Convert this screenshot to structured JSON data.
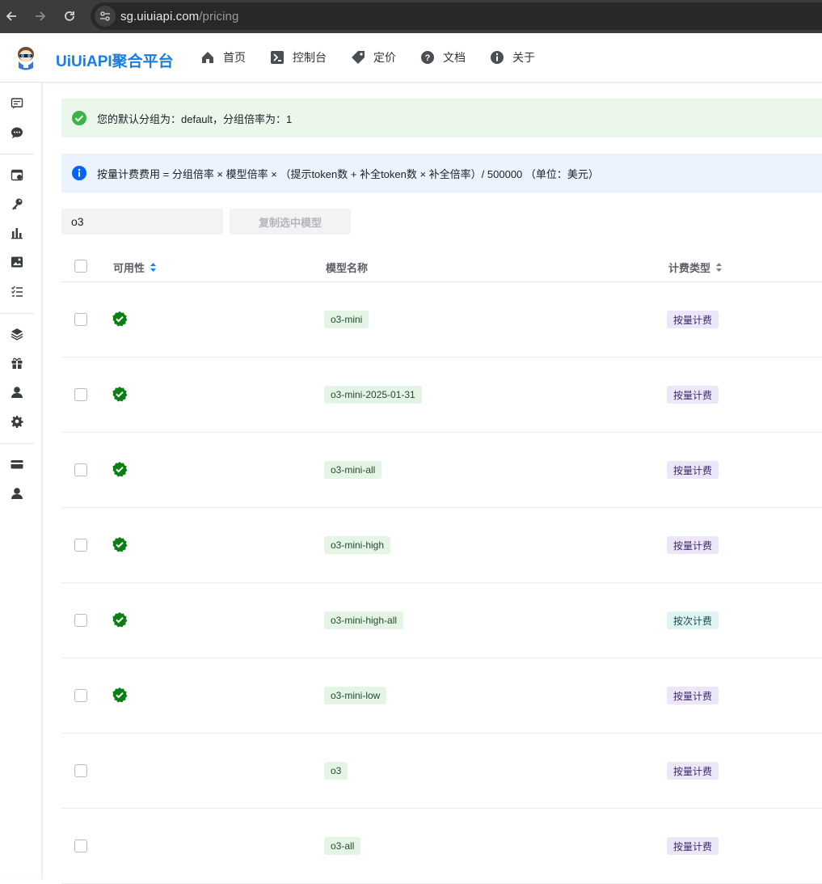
{
  "browser": {
    "url_host": "sg.uiuiapi.com",
    "url_path": "/pricing"
  },
  "header": {
    "brand": "UiUiAPI聚合平台",
    "nav": [
      {
        "label": "首页",
        "icon": "home-icon"
      },
      {
        "label": "控制台",
        "icon": "terminal-icon"
      },
      {
        "label": "定价",
        "icon": "tag-icon"
      },
      {
        "label": "文档",
        "icon": "help-icon"
      },
      {
        "label": "关于",
        "icon": "info-icon"
      }
    ]
  },
  "sidebar": {
    "items": [
      "chat-list-icon",
      "chat-bubble-icon",
      "calendar-icon",
      "key-icon",
      "bar-chart-icon",
      "image-icon",
      "task-list-icon",
      "layers-icon",
      "gift-icon",
      "user-icon",
      "settings-icon",
      "card-icon",
      "profile-icon"
    ]
  },
  "banners": {
    "group_info": "您的默认分组为：default，分组倍率为：1",
    "formula": "按量计费费用 = 分组倍率 × 模型倍率 × （提示token数 + 补全token数 × 补全倍率）/ 500000 （单位：美元）"
  },
  "search": {
    "value": "o3"
  },
  "copy_button": "复制选中模型",
  "table": {
    "columns": {
      "availability": "可用性",
      "model_name": "模型名称",
      "billing_type": "计费类型"
    },
    "rows": [
      {
        "available": true,
        "model": "o3-mini",
        "billing": "按量计费"
      },
      {
        "available": true,
        "model": "o3-mini-2025-01-31",
        "billing": "按量计费"
      },
      {
        "available": true,
        "model": "o3-mini-all",
        "billing": "按量计费"
      },
      {
        "available": true,
        "model": "o3-mini-high",
        "billing": "按量计费"
      },
      {
        "available": true,
        "model": "o3-mini-high-all",
        "billing": "按次计费"
      },
      {
        "available": true,
        "model": "o3-mini-low",
        "billing": "按量计费"
      },
      {
        "available": false,
        "model": "o3",
        "billing": "按量计费"
      },
      {
        "available": false,
        "model": "o3-all",
        "billing": "按量计费"
      }
    ]
  },
  "colors": {
    "brand": "#1a7de0",
    "success": "#0e8a16",
    "info": "#0064fa"
  }
}
